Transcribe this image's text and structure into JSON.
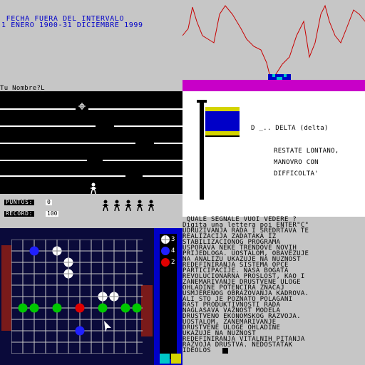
{
  "top_left": {
    "line1": " FECHA FUERA DEL INTERVALO",
    "line2": "1 ENERO 1900-31 DICIEMBRE 1999"
  },
  "name_prompt": "Tu Nombre?L",
  "score": {
    "puntos_label": "PUNTOS:",
    "puntos_value": "0",
    "record_label": "RECORD:",
    "record_value": "100"
  },
  "delta_panel": {
    "heading": "D _.. DELTA (delta)",
    "lines": [
      "RESTATE LONTANO,",
      "MANOVRO CON",
      "DIFFICOLTA'"
    ],
    "flag_colors": [
      "#0000c8",
      "#d4d400"
    ]
  },
  "text_panel": {
    "question": " QUALE SEGNALE VUOI VEDERE ?",
    "body": [
      "Digita una lettera poi ENTER\"C\"",
      "UDRUZIVANJA RADA I SREDRTAVA TE",
      "REALIZACIJA ZADATAKA IZ",
      "STABILIZACIONOG PROGRAMA",
      "USPORAVA NEKE TRENDOVE NOVIH",
      "PRIJEDLOGA. UOSTALOM, OBAVEZUJE",
      "NA ANALIZU UKAZUJE NA NUZNOST",
      "REDEFINIRANJA SISTEMA OPCE",
      "PARTICIPACIJE. NASA BOGATA",
      "REVOLUCIONARNA PROSLOST, KAO I",
      "ZANEMARIVANJE DRUSTVENE ULOGE",
      "OHLADINE POTENCIRA ZNACAJ",
      "USMJERENOG OBRAZOVANJA KADROVA.",
      "ALI STO JE POZNATO POLAGANI",
      "RAST PRODUKTIVNOSTI RADA",
      "NAGLASAVA VAZNOST MODELA",
      "DRUSTVENO EKONOMSKOG RAZVOJA.",
      "UOSTALOM, ZANEMARIVANJE",
      "DRUSTVENE ULOGE OHLADINE",
      "UKAZUJE NA NUZNOST",
      "REDEFINIRANJA VITALNIH PITANJA",
      "RAZVOJA DRUSTVA. NEDOSTATAK",
      "IDEOLOS"
    ]
  },
  "game_panel": {
    "side_counts": [
      "3",
      "4",
      "2"
    ]
  },
  "colors": {
    "magenta": "#c800c8",
    "red_line": "#c80000",
    "panel_blue": "#0000c8",
    "background": "#c6c6c6"
  }
}
